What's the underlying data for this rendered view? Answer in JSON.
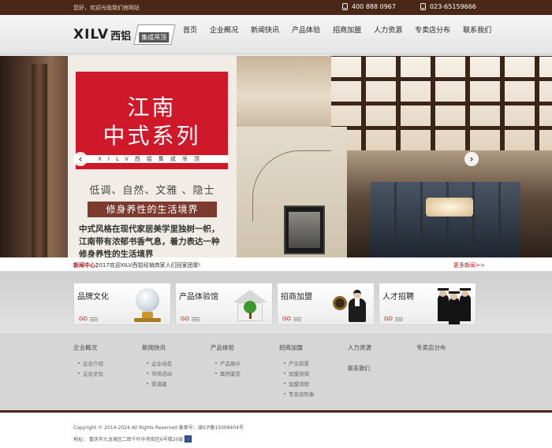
{
  "topbar": {
    "welcome": "您好，欢迎光临我们官网站",
    "phone1": "400 888 0967",
    "phone2": "023-65159666"
  },
  "header": {
    "brand": "XILV",
    "brand_cn": "西铝",
    "tag": "集成吊顶",
    "nav": [
      "首页",
      "企业概况",
      "新闻快讯",
      "产品体验",
      "招商加盟",
      "人力资源",
      "专卖店分布",
      "联系我们"
    ]
  },
  "banner": {
    "title_line1": "江南",
    "title_line2": "中式系列",
    "stripe": "XILV西铝集成吊顶",
    "sub": "低调、自然、文雅 、隐士",
    "slogan": "修身养性的生活境界",
    "desc_line1": "中式风格在现代家居美学里独树一帜，",
    "desc_line2": "江南带有浓郁书香气息，着力表达一种",
    "desc_line3": "修身养性的生活境界",
    "prev_glyph": "‹",
    "next_glyph": "›"
  },
  "news": {
    "label": "新闻中心：",
    "text": "2017欢迎XILV西铝经销商家人们回家团聚!",
    "more": "更多新闻>>"
  },
  "cards": [
    {
      "title": "品牌文化",
      "go": "GO"
    },
    {
      "title": "产品体验馆",
      "go": "GO"
    },
    {
      "title": "招商加盟",
      "go": "GO"
    },
    {
      "title": "人才招聘",
      "go": "GO"
    }
  ],
  "footer": {
    "columns": [
      {
        "heading": "企业概况",
        "items": [
          "企业介绍",
          "企业文化"
        ]
      },
      {
        "heading": "新闻快讯",
        "items": [
          "企业动态",
          "市场活动",
          "渠道建"
        ]
      },
      {
        "heading": "产品体验",
        "items": [
          "产品展示",
          "案例鉴赏"
        ]
      },
      {
        "heading": "招商加盟",
        "items": [
          "产业前景",
          "加盟咨询",
          "加盟流程",
          "专卖店形象"
        ]
      },
      {
        "heading": "人力资源",
        "items": [],
        "extra": "联系我们"
      },
      {
        "heading": "专卖店分布",
        "items": []
      }
    ]
  },
  "copyright": {
    "line1": "Copyright © 2014-2024 All Rights Reserved   备案号：渝ICP备15008404号",
    "line2": "地址： 重庆市九龙坡区二郎千叶中央街区6号楼20层"
  },
  "colors": {
    "brand_brown": "#4a2716",
    "accent_red": "#d0182b"
  }
}
